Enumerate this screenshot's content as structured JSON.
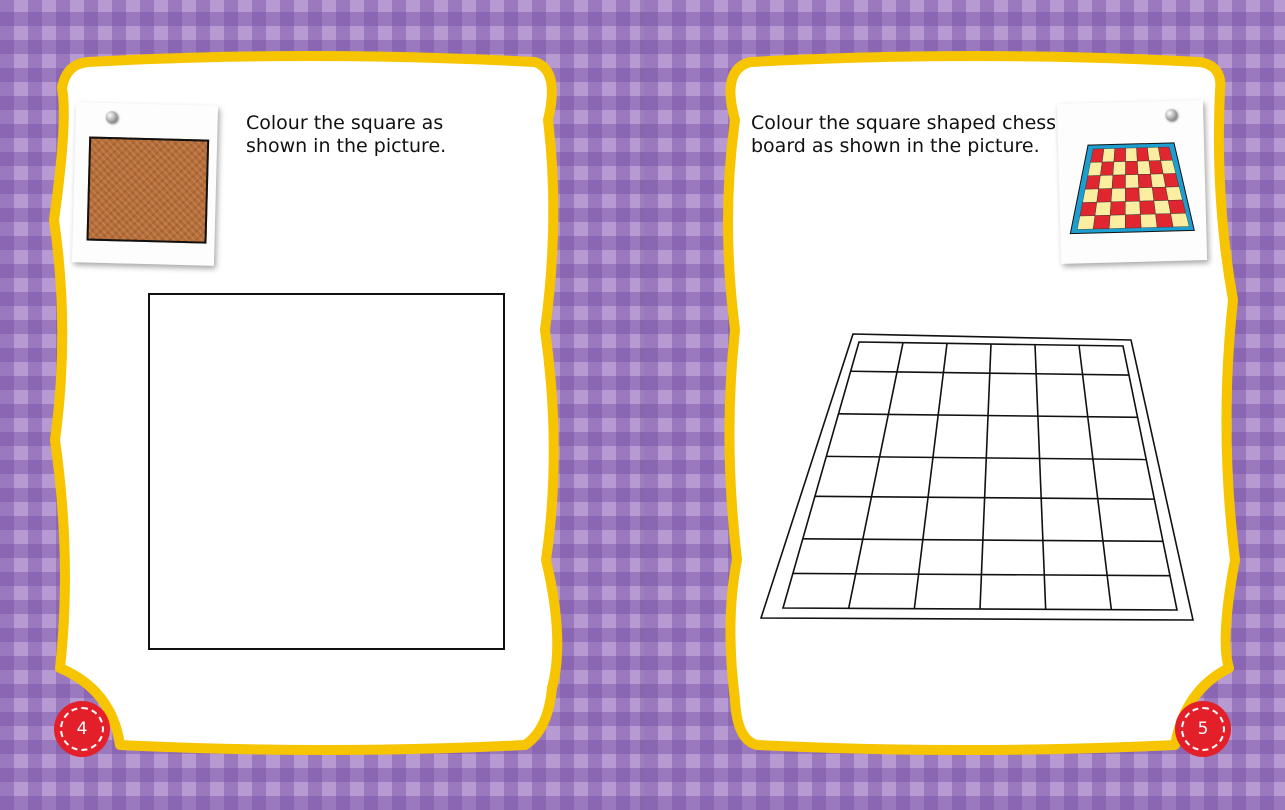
{
  "colors": {
    "frame": "#f7c400",
    "badge": "#e32029",
    "background_light": "#c4a9dc",
    "background_dark": "#8f66b8",
    "sample_square": "#b86c36",
    "chess_red": "#e0262e",
    "chess_cream": "#fbeea0",
    "chess_border": "#1c9fd0"
  },
  "left_page": {
    "instruction_line1": "Colour the square as",
    "instruction_line2": "shown in the picture.",
    "page_number": "4",
    "sample_icon": "brown-crayon-square"
  },
  "right_page": {
    "instruction_line1": "Colour the square shaped chess",
    "instruction_line2": "board as shown in the picture.",
    "page_number": "5",
    "sample_icon": "coloured-chessboard"
  }
}
